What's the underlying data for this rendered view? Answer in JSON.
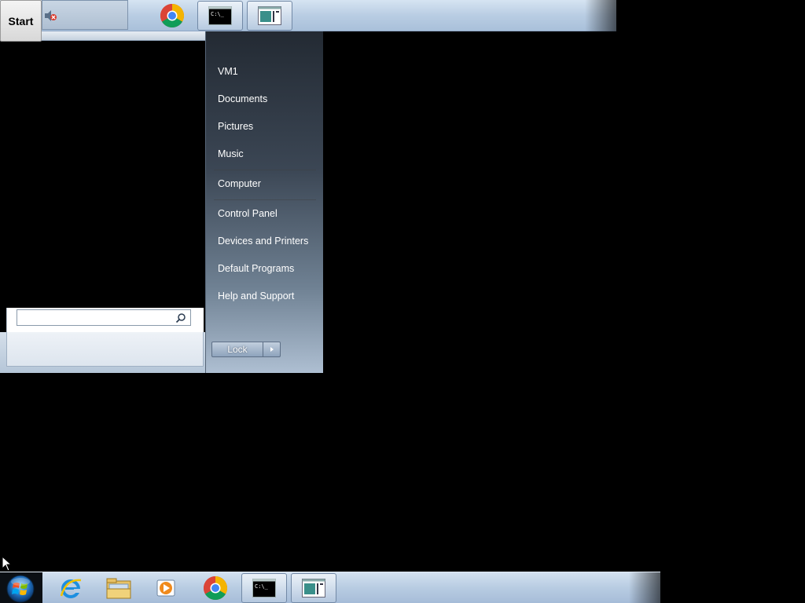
{
  "top_taskbar": {
    "start_label": "Start",
    "buttons": [
      {
        "name": "chrome",
        "active": false
      },
      {
        "name": "cmd",
        "active": true
      },
      {
        "name": "window",
        "active": true
      }
    ]
  },
  "start_menu": {
    "search": {
      "value": "",
      "placeholder": ""
    },
    "right_items": [
      {
        "label": "VM1"
      },
      {
        "label": "Documents"
      },
      {
        "label": "Pictures"
      },
      {
        "label": "Music"
      },
      {
        "label": "Computer"
      },
      {
        "label": "Control Panel"
      },
      {
        "label": "Devices and Printers"
      },
      {
        "label": "Default Programs"
      },
      {
        "label": "Help and Support"
      }
    ],
    "lock_label": "Lock"
  },
  "bottom_taskbar": {
    "pinned": [
      {
        "name": "internet-explorer"
      },
      {
        "name": "file-explorer"
      },
      {
        "name": "media-player"
      },
      {
        "name": "chrome"
      },
      {
        "name": "cmd",
        "active": true
      },
      {
        "name": "window",
        "active": true
      }
    ]
  },
  "icons": {
    "cmd_glyph": "C:\\_"
  }
}
